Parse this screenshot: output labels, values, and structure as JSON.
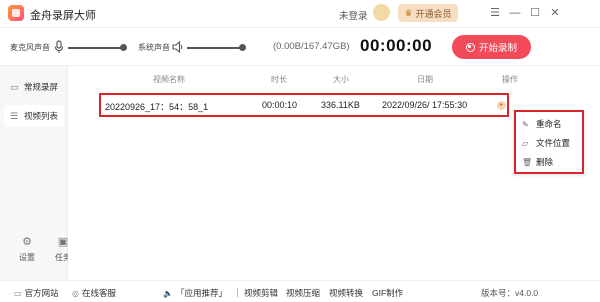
{
  "app": {
    "title": "金舟录屏大师"
  },
  "header": {
    "login_text": "未登录",
    "vip_label": "开通会员"
  },
  "window_controls": {
    "menu": "☰",
    "minimize": "—",
    "maximize": "☐",
    "close": "✕"
  },
  "controls": {
    "mic_label": "麦克风声音",
    "mic_level": 0.95,
    "system_label": "系统声音",
    "system_level": 0.95,
    "storage": "(0.00B/167.47GB)",
    "timer": "00:00:00",
    "record_label": "开始录制"
  },
  "sidebar": {
    "items": [
      {
        "label": "常规录屏",
        "icon": "screen-record-icon"
      },
      {
        "label": "视频列表",
        "icon": "list-icon",
        "active": true
      }
    ],
    "bottom": [
      {
        "label": "设置",
        "icon": "gear-icon"
      },
      {
        "label": "任务",
        "icon": "task-icon"
      }
    ]
  },
  "table": {
    "headers": [
      "视频名称",
      "时长",
      "大小",
      "日期",
      "操作"
    ],
    "rows": [
      {
        "name": "20220926_17：54：58_1",
        "duration": "00:00:10",
        "size": "336.11KB",
        "date": "2022/09/26/ 17:55:30"
      }
    ]
  },
  "context_menu": {
    "items": [
      {
        "label": "重命名",
        "icon": "rename-icon"
      },
      {
        "label": "文件位置",
        "icon": "folder-icon"
      },
      {
        "label": "删除",
        "icon": "trash-icon"
      }
    ]
  },
  "footer": {
    "official_site": "官方网站",
    "online_service": "在线客服",
    "recommend": "「应用推荐」",
    "links": [
      "视频剪辑",
      "视频压缩",
      "视频转换",
      "GIF制作"
    ],
    "version": "版本号：v4.0.0"
  },
  "colors": {
    "record_button": "#f24a58",
    "highlight_border": "#d9252a",
    "vip_bg": "#f7dfc4"
  }
}
